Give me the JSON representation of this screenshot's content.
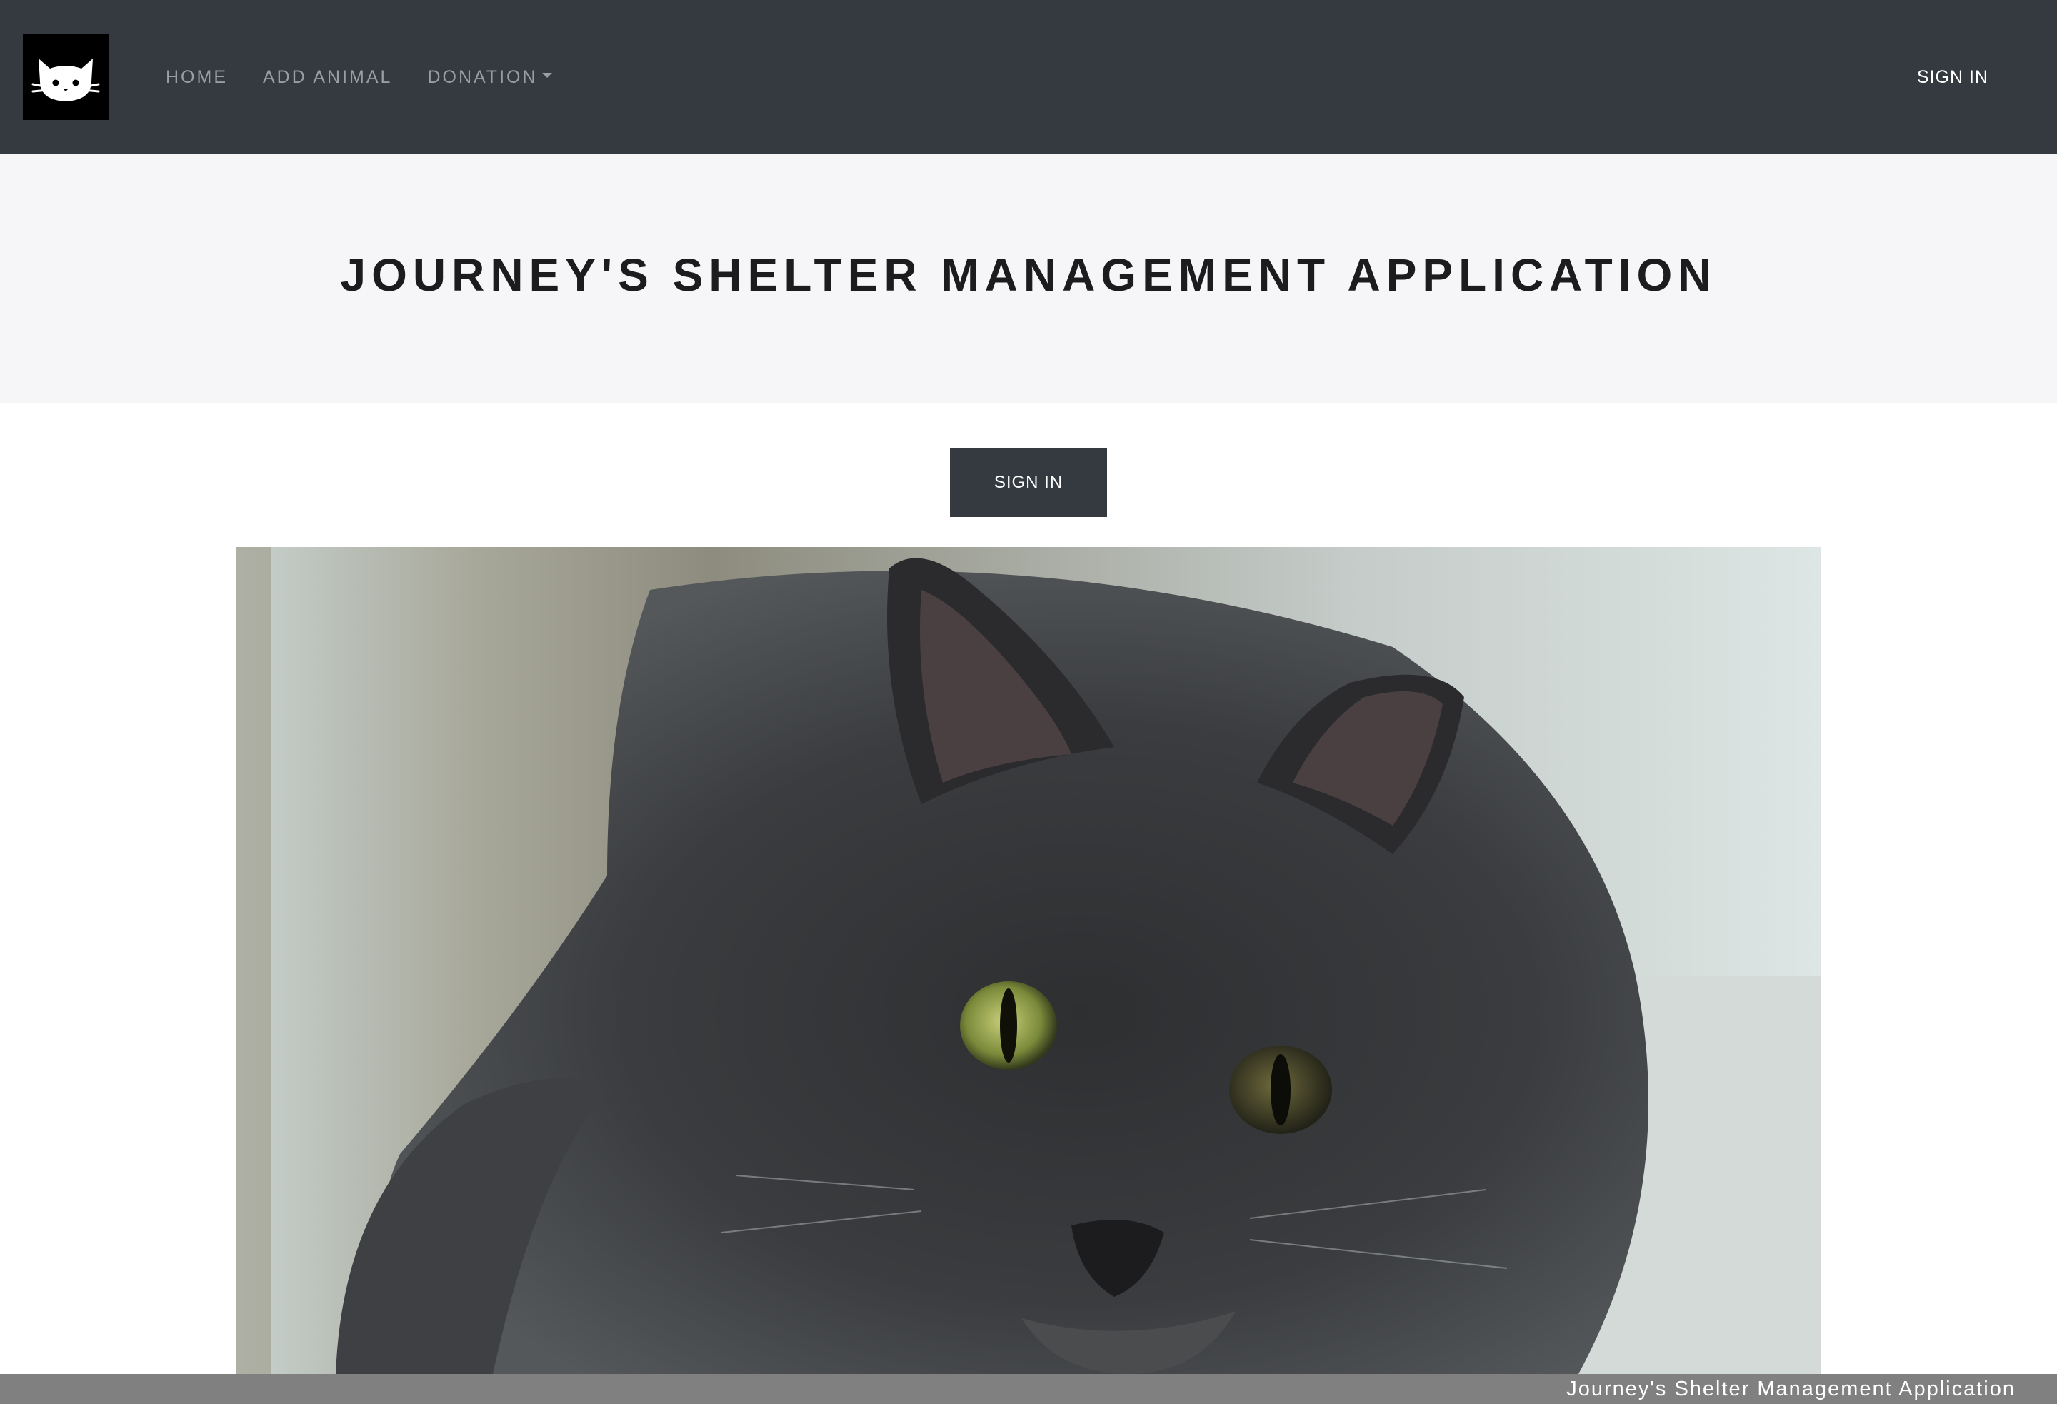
{
  "navbar": {
    "logo_icon": "cat-face-icon",
    "links": [
      {
        "label": "HOME"
      },
      {
        "label": "ADD ANIMAL"
      },
      {
        "label": "DONATION",
        "icon": "caret-down-icon"
      }
    ],
    "signin_label": "SIGN IN"
  },
  "hero": {
    "title": "JOURNEY'S SHELTER MANAGEMENT APPLICATION"
  },
  "main": {
    "signin_button_label": "SIGN IN",
    "photo_subject": "gray long-haired cat"
  },
  "footer": {
    "text": "Journey's Shelter Management Application"
  },
  "colors": {
    "navbar_bg": "#343a40",
    "hero_bg": "#f6f6f8",
    "footer_bg": "#808080",
    "button_bg": "#343a40"
  }
}
